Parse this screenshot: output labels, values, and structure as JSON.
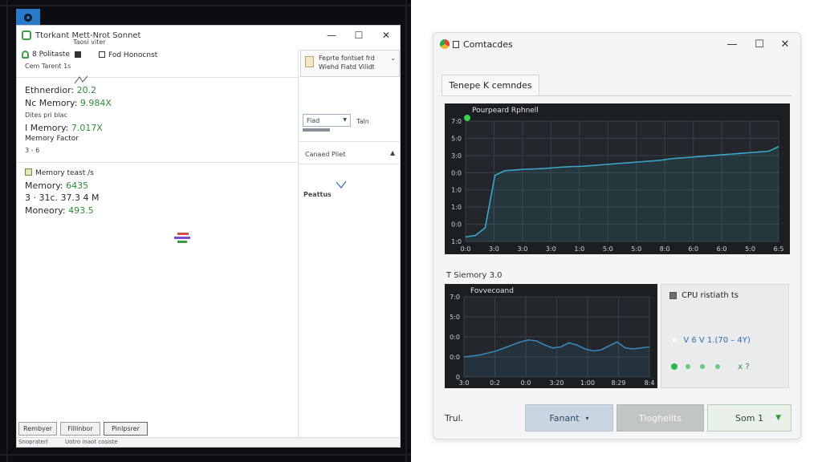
{
  "desktop": {
    "icon": "circle-icon"
  },
  "left_window": {
    "title": "Ttorkant Mett-Nrot Sonnet",
    "subtitle": "Taosi viter",
    "controls": {
      "minimize": "—",
      "maximize": "☐",
      "close": "✕"
    },
    "toolbar": {
      "item1": "8 Politaste",
      "item2": "Fod Honocnst"
    },
    "summary_line": "Cem Tarent  1s",
    "stats": [
      {
        "label": "Ethnerdior: ",
        "value": "20.2"
      },
      {
        "label": "Nc Memory: ",
        "value": "9.984X"
      }
    ],
    "note1": "Dites pri blac",
    "stats2": [
      {
        "label": "I Memory: ",
        "value": "7.017X"
      }
    ],
    "memory_factor": "Memory Factor",
    "small_note": "3 - 6",
    "memory_section": {
      "title": "Memory teast  /s",
      "rows": [
        {
          "label": "Memory: ",
          "value": "6435"
        },
        {
          "label": "3 · 31c. ",
          "value": "37.3 4 M"
        },
        {
          "label": "Moneory: ",
          "value": "493.5"
        }
      ]
    },
    "right_panel": {
      "doc_line1": "Feprte fontset frd",
      "doc_line2": "Wiehd Fiatd Vilidt",
      "select_value": "Fiad",
      "select_label": "Taln",
      "section": "Canaed Pliet",
      "bottom_label": "Peattus"
    },
    "buttons": [
      "Rembyer",
      "Fillinbor",
      "Pinlpsrer"
    ],
    "status": {
      "left": "Snopraterl",
      "right": "Uotro inaot cosiste"
    }
  },
  "right_window": {
    "title": "Comtacdes",
    "controls": {
      "minimize": "—",
      "maximize": "☐",
      "close": "✕"
    },
    "tab": "Tenepe  K cemndes",
    "chart1_label": "T Siemory 3.0",
    "cpu_panel": {
      "title": "CPU ristiath ts",
      "row1": "V   6   V   1.(70 – 4Y)",
      "row2": "x   ?"
    },
    "footer_label": "Trul.",
    "buttons": {
      "a": "Fanant",
      "b": "Tiogheilts",
      "c": "Som 1"
    }
  },
  "chart_data": [
    {
      "type": "line",
      "legend": [
        "Pourpeard Rphnell"
      ],
      "x_ticks": [
        "0:0",
        "3:0",
        "3:0",
        "3:0",
        "1:0",
        "5:0",
        "5:0",
        "8:0",
        "6:0",
        "6:0",
        "5:0",
        "6:5"
      ],
      "y_ticks": [
        "7:0",
        "5:0",
        "3:0",
        "0:0",
        "1:0",
        "1:0",
        "0:0",
        "1:0"
      ],
      "ylim": [
        0,
        8
      ],
      "grid": true,
      "series": [
        {
          "color": "#3aa7c8",
          "values": [
            0.3,
            0.4,
            0.9,
            4.4,
            4.7,
            4.75,
            4.8,
            4.82,
            4.85,
            4.9,
            4.95,
            4.98,
            5.0,
            5.05,
            5.1,
            5.15,
            5.2,
            5.25,
            5.3,
            5.35,
            5.4,
            5.5,
            5.55,
            5.6,
            5.65,
            5.7,
            5.75,
            5.8,
            5.85,
            5.9,
            5.95,
            6.0,
            6.3
          ]
        }
      ]
    },
    {
      "type": "line",
      "legend": [
        "Fovvecoand"
      ],
      "x_ticks": [
        "3:0",
        "0:2",
        "0:0",
        "3:20",
        "1:00",
        "8:29",
        "8:4"
      ],
      "y_ticks": [
        "7:0",
        "5:0",
        "0:0",
        "0:0",
        "0"
      ],
      "ylim": [
        0,
        4
      ],
      "grid": true,
      "series": [
        {
          "color": "#3a86b8",
          "values": [
            1.0,
            1.05,
            1.1,
            1.2,
            1.3,
            1.45,
            1.6,
            1.75,
            1.85,
            1.8,
            1.6,
            1.45,
            1.5,
            1.7,
            1.6,
            1.4,
            1.3,
            1.35,
            1.55,
            1.75,
            1.45,
            1.4,
            1.45,
            1.5
          ]
        }
      ]
    }
  ]
}
